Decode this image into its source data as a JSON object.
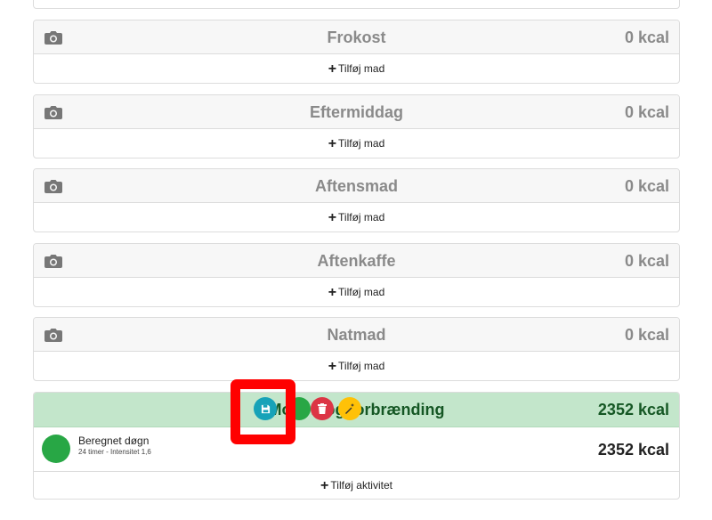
{
  "meals": [
    {
      "title": "Frokost",
      "kcal": "0 kcal",
      "add_label": "Tilføj mad"
    },
    {
      "title": "Eftermiddag",
      "kcal": "0 kcal",
      "add_label": "Tilføj mad"
    },
    {
      "title": "Aftensmad",
      "kcal": "0 kcal",
      "add_label": "Tilføj mad"
    },
    {
      "title": "Aftenkaffe",
      "kcal": "0 kcal",
      "add_label": "Tilføj mad"
    },
    {
      "title": "Natmad",
      "kcal": "0 kcal",
      "add_label": "Tilføj mad"
    }
  ],
  "activity": {
    "title": "Motion og forbrænding",
    "kcal": "2352 kcal",
    "item": {
      "name": "Beregnet døgn",
      "detail": "24 timer - Intensitet 1,6",
      "kcal": "2352 kcal"
    },
    "add_label": "Tilføj aktivitet"
  },
  "colors": {
    "save": "#17a2b8",
    "delete": "#dc3545",
    "magic": "#ffc107",
    "activity_bg": "#c3e6cb",
    "activity_dot": "#28a745",
    "highlight": "#ff0000"
  },
  "icons": {
    "meal": "camera-icon",
    "save": "floppy-disk-icon",
    "delete": "trash-icon",
    "magic": "magic-wand-icon",
    "add": "plus-icon"
  }
}
